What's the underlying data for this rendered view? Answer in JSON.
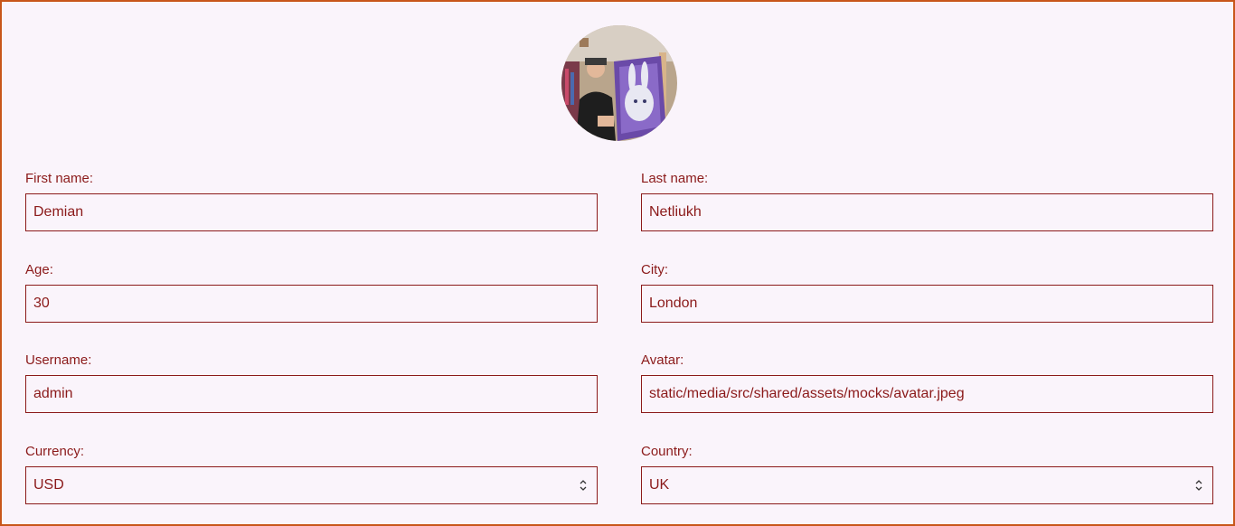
{
  "profile": {
    "avatar_icon": "avatar-photo-icon"
  },
  "form": {
    "first_name": {
      "label": "First name:",
      "value": "Demian"
    },
    "last_name": {
      "label": "Last name:",
      "value": "Netliukh"
    },
    "age": {
      "label": "Age:",
      "value": "30"
    },
    "city": {
      "label": "City:",
      "value": "London"
    },
    "username": {
      "label": "Username:",
      "value": "admin"
    },
    "avatar": {
      "label": "Avatar:",
      "value": "static/media/src/shared/assets/mocks/avatar.jpeg"
    },
    "currency": {
      "label": "Currency:",
      "value": "USD"
    },
    "country": {
      "label": "Country:",
      "value": "UK"
    }
  },
  "colors": {
    "frame_border": "#c8561a",
    "background": "#faf4fb",
    "primary": "#8b1a1a"
  }
}
